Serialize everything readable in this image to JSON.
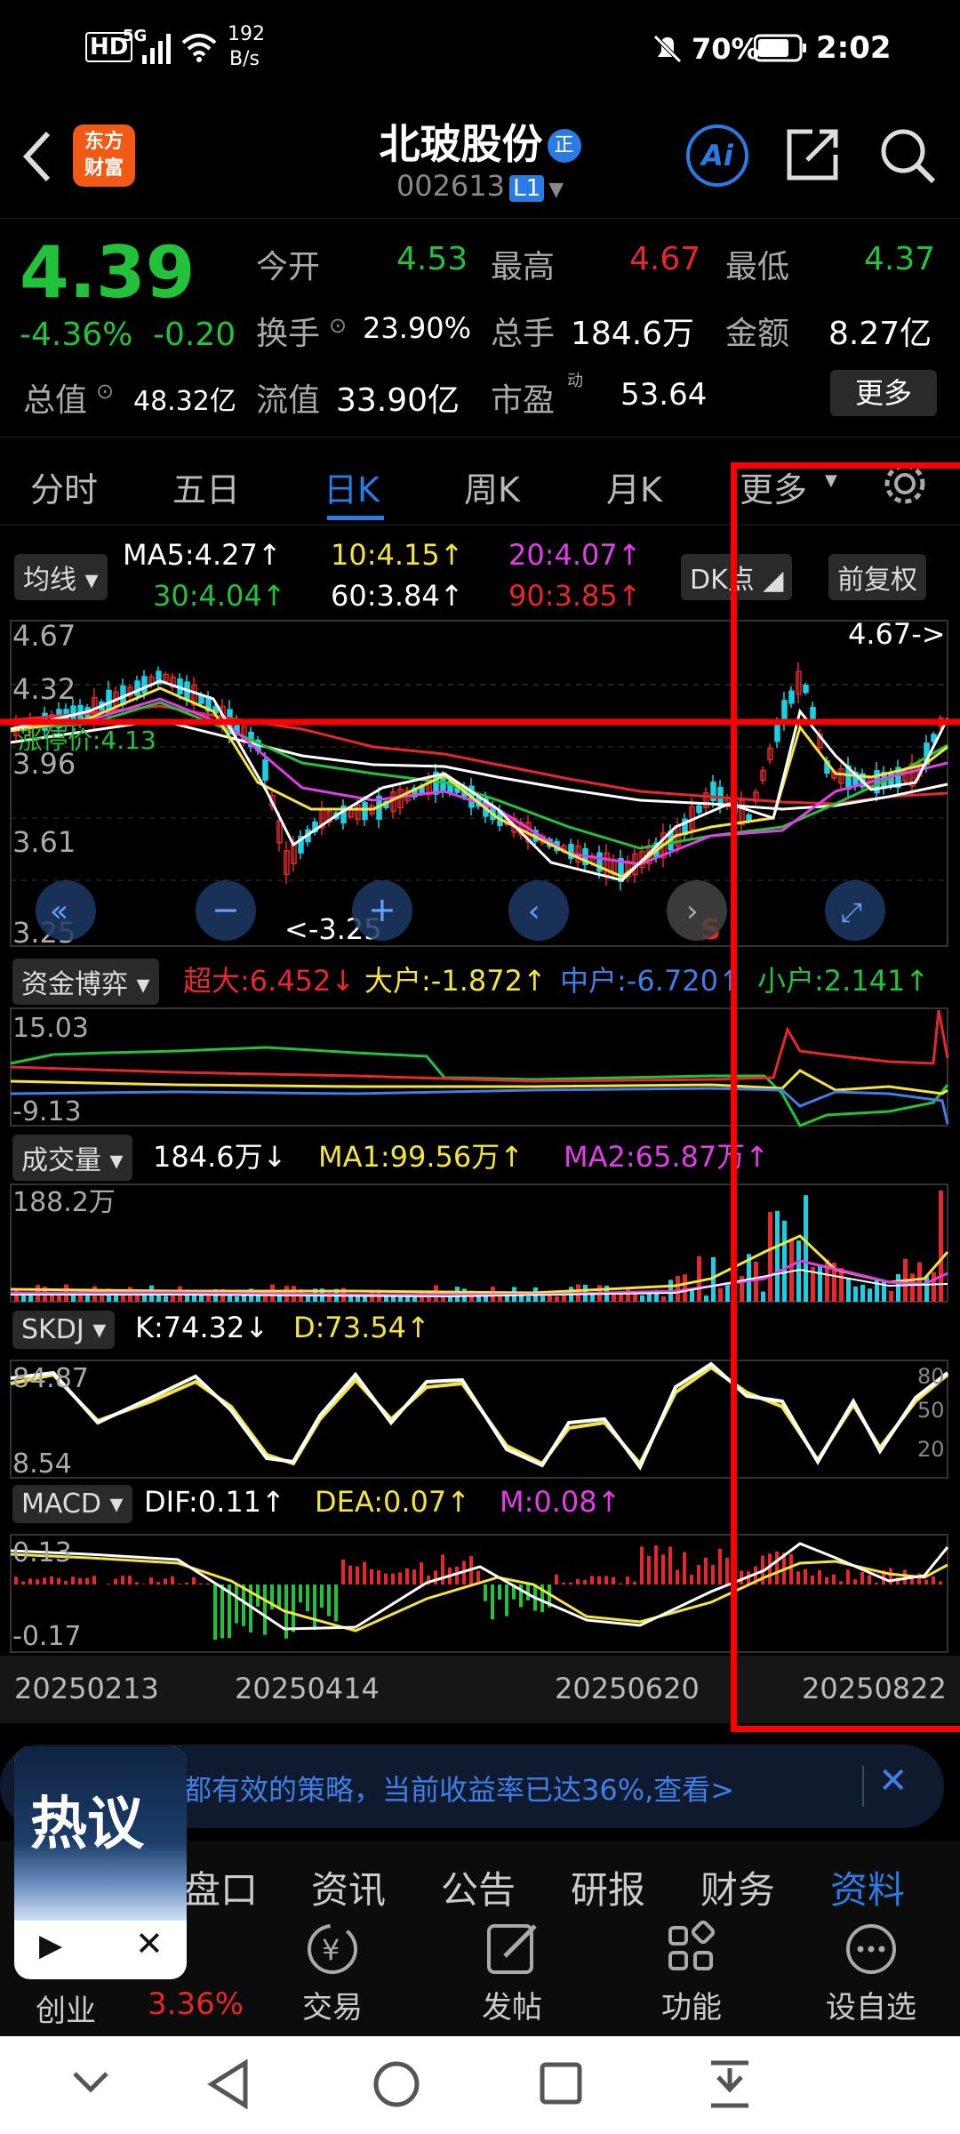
{
  "status": {
    "hd": "HD",
    "network": "5G",
    "speed": "192",
    "speed_unit": "B/s",
    "battery": "70%",
    "time": "2:02"
  },
  "header": {
    "title": "北玻股份",
    "badge": "正",
    "code": "002613",
    "level": "L1",
    "logo_line1": "东方",
    "logo_line2": "财富"
  },
  "quote": {
    "price": "4.39",
    "change_pct": "-4.36%",
    "change": "-0.20",
    "open_label": "今开",
    "open": "4.53",
    "high_label": "最高",
    "high": "4.67",
    "low_label": "最低",
    "low": "4.37",
    "turnover_label": "换手",
    "turnover": "23.90%",
    "volume_label": "总手",
    "volume": "184.6万",
    "amount_label": "金额",
    "amount": "8.27亿",
    "mktcap_label": "总值",
    "mktcap": "48.32亿",
    "float_label": "流值",
    "float": "33.90亿",
    "pe_label": "市盈",
    "pe_sup": "动",
    "pe": "53.64",
    "more": "更多"
  },
  "tabs": [
    "分时",
    "五日",
    "日K",
    "周K",
    "月K",
    "更多"
  ],
  "ma": {
    "label": "均线",
    "ma5": "MA5:4.27↑",
    "ma10": "10:4.15↑",
    "ma20": "20:4.07↑",
    "ma30": "30:4.04↑",
    "ma60": "60:3.84↑",
    "ma90": "90:3.85↑",
    "dk": "DK点",
    "fq": "前复权"
  },
  "kline": {
    "y_top": "4.67",
    "y2": "4.32",
    "y3": "3.96",
    "y4": "3.61",
    "y_bottom": "3.25",
    "high_marker": "4.67->",
    "low_marker": "<-3.25",
    "limit_label": "涨停价:4.13",
    "s_marker": "S"
  },
  "funds": {
    "label": "资金博弈",
    "super": "超大:6.452↓",
    "big": "大户:-1.872↑",
    "mid": "中户:-6.720↑",
    "small": "小户:2.141↑",
    "y_top": "15.03",
    "y_bottom": "-9.13"
  },
  "vol": {
    "label": "成交量",
    "value": "184.6万↓",
    "ma1": "MA1:99.56万↑",
    "ma2": "MA2:65.87万↑",
    "y_top": "188.2万"
  },
  "skdj": {
    "label": "SKDJ",
    "k": "K:74.32↓",
    "d": "D:73.54↑",
    "y_top": "84.87",
    "y_bottom": "8.54",
    "r80": "80",
    "r50": "50",
    "r20": "20"
  },
  "macd": {
    "label": "MACD",
    "dif": "DIF:0.11↑",
    "dea": "DEA:0.07↑",
    "m": "M:0.08↑",
    "y_top": "0.13",
    "y_bottom": "-0.17"
  },
  "dates": [
    "20250213",
    "20250414",
    "20250620",
    "20250822"
  ],
  "banner": {
    "text": "都有效的策略，当前收益率已达36%,查看>",
    "close": "✕"
  },
  "hot": {
    "title": "热议"
  },
  "subtabs": [
    "盘口",
    "资讯",
    "公告",
    "研报",
    "财务",
    "资料"
  ],
  "bottom_actions": [
    {
      "label": "创业",
      "value": "3.36%"
    },
    {
      "label": "交易",
      "icon": "yen-icon"
    },
    {
      "label": "发帖",
      "icon": "edit-icon"
    },
    {
      "label": "功能",
      "icon": "grid-icon"
    },
    {
      "label": "设自选",
      "icon": "more-icon"
    }
  ],
  "colors": {
    "up": "#e8262b",
    "down": "#22c33a",
    "cyan": "#1ad0e6",
    "highlight": "#ff0000",
    "accent": "#2a7be4"
  }
}
